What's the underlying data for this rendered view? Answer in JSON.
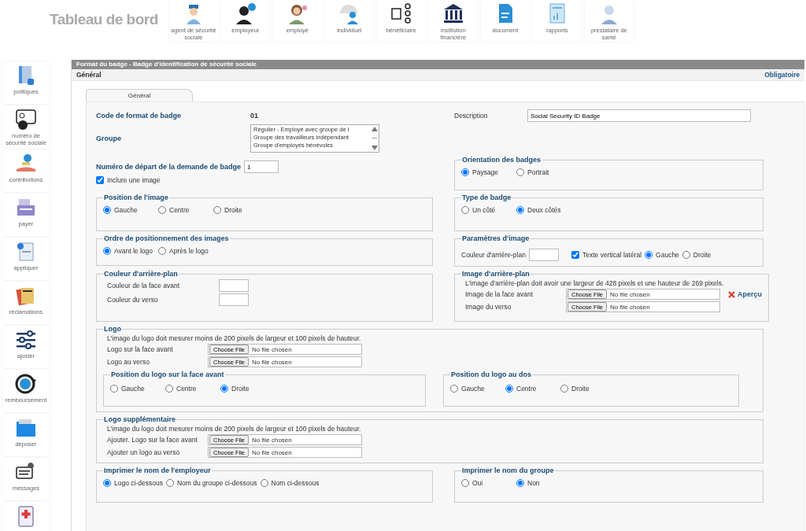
{
  "header": {
    "title": "Tableau de bord"
  },
  "top_nav": [
    {
      "label": "agent de sécurité sociale"
    },
    {
      "label": "employeur"
    },
    {
      "label": "employé"
    },
    {
      "label": "individuel"
    },
    {
      "label": "bénéficiaire"
    },
    {
      "label": "institution financière"
    },
    {
      "label": "document"
    },
    {
      "label": "rapports"
    },
    {
      "label": "prestataire de santé"
    }
  ],
  "sidebar": [
    {
      "label": "politiques"
    },
    {
      "label": "numéro de sécurité sociale"
    },
    {
      "label": "contributions"
    },
    {
      "label": "payer"
    },
    {
      "label": "appliquer"
    },
    {
      "label": "réclamations"
    },
    {
      "label": "ajuster"
    },
    {
      "label": "remboursement"
    },
    {
      "label": "déposer"
    },
    {
      "label": "messages"
    }
  ],
  "panel": {
    "title": "Format du badge - Badge d'identification de sécurité sociale",
    "section": "Général",
    "required_link": "Obligatoire",
    "tabs": [
      {
        "label": "Général",
        "selected": true
      }
    ]
  },
  "form": {
    "badge_code": {
      "label": "Code de format de badge",
      "value": "01"
    },
    "description": {
      "label": "Description",
      "value": "Social Security ID Badge"
    },
    "group": {
      "label": "Groupe",
      "options": [
        "Régulier - Employé avec groupe de l",
        "Groupe des travailleurs indépendant",
        "Groupe d'employés bénévoles"
      ]
    },
    "sections": [
      {
        "kind": "pair",
        "left": [
          {
            "kind": "field",
            "label": "Numéro de départ de la demande de badge",
            "value": "1"
          },
          {
            "kind": "checkbox",
            "label": "Inclure une image",
            "checked": true
          }
        ],
        "right": [
          {
            "kind": "fieldset",
            "legend": "Orientation des badges",
            "rows": [
              {
                "kind": "radios",
                "options": [
                  {
                    "label": "Paysage",
                    "selected": true
                  },
                  {
                    "label": "Portrait",
                    "selected": false
                  }
                ]
              }
            ]
          }
        ]
      },
      {
        "kind": "pair",
        "left": [
          {
            "kind": "fieldset",
            "legend": "Position de l'image",
            "rows": [
              {
                "kind": "radios",
                "options": [
                  {
                    "label": "Gauche",
                    "selected": true
                  },
                  {
                    "label": "Centre",
                    "selected": false
                  },
                  {
                    "label": "Droite",
                    "selected": false
                  }
                ]
              }
            ]
          }
        ],
        "right": [
          {
            "kind": "fieldset",
            "legend": "Type de badge",
            "rows": [
              {
                "kind": "radios",
                "options": [
                  {
                    "label": "Un côté",
                    "selected": false
                  },
                  {
                    "label": "Deux côtés",
                    "selected": true
                  }
                ]
              }
            ]
          }
        ]
      },
      {
        "kind": "pair",
        "left": [
          {
            "kind": "fieldset",
            "legend": "Ordre de positionnement des images",
            "rows": [
              {
                "kind": "radios",
                "options": [
                  {
                    "label": "Avant le logo",
                    "selected": true
                  },
                  {
                    "label": "Après le logo",
                    "selected": false
                  }
                ]
              }
            ]
          }
        ],
        "right": [
          {
            "kind": "fieldset",
            "legend": "Paramètres d'image",
            "rows": [
              {
                "kind": "params",
                "color_label": "Couleur d'arrière-plan",
                "checkbox": {
                  "label": "Texte vertical latéral",
                  "checked": true
                },
                "options": [
                  {
                    "label": "Gauche",
                    "selected": true
                  },
                  {
                    "label": "Droite",
                    "selected": false
                  }
                ]
              }
            ]
          }
        ]
      },
      {
        "kind": "pair",
        "left": [
          {
            "kind": "fieldset",
            "legend": "Couleur d'arrière-plan",
            "rows": [
              {
                "kind": "color",
                "label": "Couleur de la face avant"
              },
              {
                "kind": "color",
                "label": "Couleur du verso"
              }
            ]
          }
        ],
        "right": [
          {
            "kind": "fieldset",
            "legend": "Image d'arrière-plan",
            "rows": [
              {
                "kind": "note",
                "text": "L'image d'arrière-plan doit avoir une largeur de 428 pixels et une hauteur de 269 pixels."
              },
              {
                "kind": "file",
                "label": "Image de la face avant",
                "button": "Choose File",
                "status": "No file chosen",
                "link": "Aperçu"
              },
              {
                "kind": "file",
                "label": "Image du verso",
                "button": "Choose File",
                "status": "No file chosen"
              }
            ]
          }
        ]
      },
      {
        "kind": "full",
        "fieldset": {
          "legend": "Logo",
          "rows": [
            {
              "kind": "note",
              "text": "L'image du logo doit mesurer moins de 200 pixels de largeur et 100 pixels de hauteur."
            },
            {
              "kind": "file",
              "label": "Logo sur la face avant",
              "button": "Choose File",
              "status": "No file chosen"
            },
            {
              "kind": "file",
              "label": "Logo au verso",
              "button": "Choose File",
              "status": "No file chosen"
            },
            {
              "kind": "subpair",
              "groups": [
                {
                  "legend": "Position du logo sur la face avant",
                  "options": [
                    {
                      "label": "Gauche",
                      "selected": false
                    },
                    {
                      "label": "Centre",
                      "selected": false
                    },
                    {
                      "label": "Droite",
                      "selected": true
                    }
                  ]
                },
                {
                  "legend": "Position du logo au dos",
                  "options": [
                    {
                      "label": "Gauche",
                      "selected": false
                    },
                    {
                      "label": "Centre",
                      "selected": true
                    },
                    {
                      "label": "Droite",
                      "selected": false
                    }
                  ]
                }
              ]
            }
          ]
        }
      },
      {
        "kind": "full",
        "fieldset": {
          "legend": "Logo supplémentaire",
          "rows": [
            {
              "kind": "note",
              "text": "L'image du logo doit mesurer moins de 200 pixels de largeur et 100 pixels de hauteur."
            },
            {
              "kind": "file",
              "label": "Ajouter. Logo sur la face avant",
              "button": "Choose File",
              "status": "No file chosen"
            },
            {
              "kind": "file",
              "label": "Ajouter un logo au verso",
              "button": "Choose File",
              "status": "No file chosen"
            }
          ]
        }
      },
      {
        "kind": "pair",
        "left": [
          {
            "kind": "fieldset",
            "legend": "Imprimer le nom de l'employeur",
            "rows": [
              {
                "kind": "radios",
                "options": [
                  {
                    "label": "Logo ci-dessous",
                    "selected": true
                  },
                  {
                    "label": "Nom du groupe ci-dessous",
                    "selected": false
                  },
                  {
                    "label": "Nom ci-dessous",
                    "selected": false
                  }
                ]
              }
            ]
          }
        ],
        "right": [
          {
            "kind": "fieldset",
            "legend": "Imprimer le nom du groupe",
            "rows": [
              {
                "kind": "radios",
                "options": [
                  {
                    "label": "Oui",
                    "selected": false
                  },
                  {
                    "label": "Non",
                    "selected": true
                  }
                ]
              }
            ]
          }
        ]
      }
    ]
  }
}
